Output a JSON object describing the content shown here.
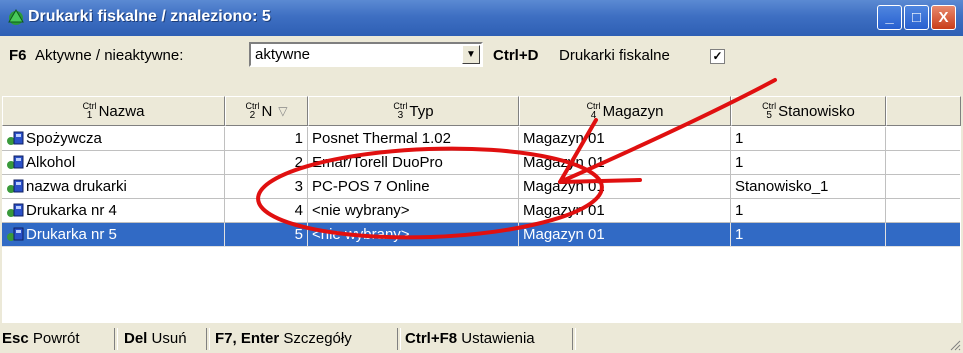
{
  "window": {
    "title": "Drukarki fiskalne / znaleziono: 5",
    "minimize": "_",
    "maximize": "□",
    "close": "X"
  },
  "toolbar": {
    "f6_key": "F6",
    "f6_label": "Aktywne / nieaktywne:",
    "select_value": "aktywne",
    "select_arrow": "▼",
    "ctrld_key": "Ctrl+D",
    "ctrld_label": "Drukarki fiskalne",
    "checkbox_mark": "☑"
  },
  "columns": [
    {
      "key": "Ctrl",
      "num": "1",
      "label": "Nazwa"
    },
    {
      "key": "Ctrl",
      "num": "2",
      "label": "N",
      "sort": "▽"
    },
    {
      "key": "Ctrl",
      "num": "3",
      "label": "Typ"
    },
    {
      "key": "Ctrl",
      "num": "4",
      "label": "Magazyn"
    },
    {
      "key": "Ctrl",
      "num": "5",
      "label": "Stanowisko"
    }
  ],
  "rows": [
    {
      "name": "Spożywcza",
      "n": "1",
      "typ": "Posnet Thermal 1.02",
      "magazyn": "Magazyn 01",
      "stanowisko": "1"
    },
    {
      "name": "Alkohol",
      "n": "2",
      "typ": "Emar/Torell DuoPro",
      "magazyn": "Magazyn 01",
      "stanowisko": "1"
    },
    {
      "name": "nazwa drukarki",
      "n": "3",
      "typ": "PC-POS 7 Online",
      "magazyn": "Magazyn 01",
      "stanowisko": "Stanowisko_1"
    },
    {
      "name": "Drukarka nr 4",
      "n": "4",
      "typ": "<nie wybrany>",
      "magazyn": "Magazyn 01",
      "stanowisko": "1"
    },
    {
      "name": "Drukarka nr 5",
      "n": "5",
      "typ": "<nie wybrany>",
      "magazyn": "Magazyn 01",
      "stanowisko": "1",
      "selected": true
    }
  ],
  "statusbar": [
    {
      "key": "Esc",
      "label": "Powrót"
    },
    {
      "key": "Del",
      "label": "Usuń"
    },
    {
      "key": "F7, Enter",
      "label": "Szczegóły"
    },
    {
      "key": "Ctrl+F8",
      "label": "Ustawienia"
    }
  ],
  "colors": {
    "titlebar": "#2e5fb4",
    "selection": "#316ac5",
    "annotation": "#e01010"
  },
  "icons": {
    "title": "printer-globe-icon",
    "row": "printer-icon"
  }
}
